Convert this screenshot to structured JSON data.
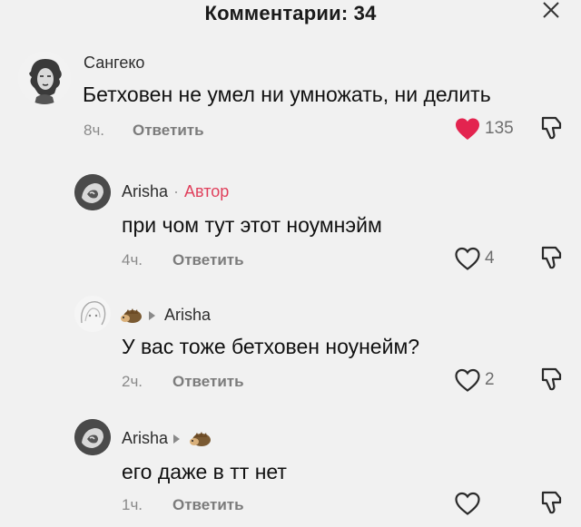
{
  "header": {
    "title": "Комментарии: 34"
  },
  "colors": {
    "liked_heart": "#e3244f",
    "author_tag": "#e0405c",
    "background": "#f1f1f1"
  },
  "comments": [
    {
      "username": "Сангеко",
      "text": "Бетховен не умел ни умножать, ни делить",
      "time": "8ч.",
      "reply_label": "Ответить",
      "likes": "135",
      "liked": true
    },
    {
      "username": "Arisha",
      "separator": "·",
      "author_tag": "Автор",
      "text": "при чом тут этот ноумнэйм",
      "time": "4ч.",
      "reply_label": "Ответить",
      "likes": "4",
      "liked": false
    },
    {
      "reply_to": "Arisha",
      "text": "У вас тоже бетховен ноунейм?",
      "time": "2ч.",
      "reply_label": "Ответить",
      "likes": "2",
      "liked": false
    },
    {
      "username": "Arisha",
      "text": "его даже в тт нет",
      "time": "1ч.",
      "reply_label": "Ответить",
      "likes": "",
      "liked": false
    }
  ]
}
